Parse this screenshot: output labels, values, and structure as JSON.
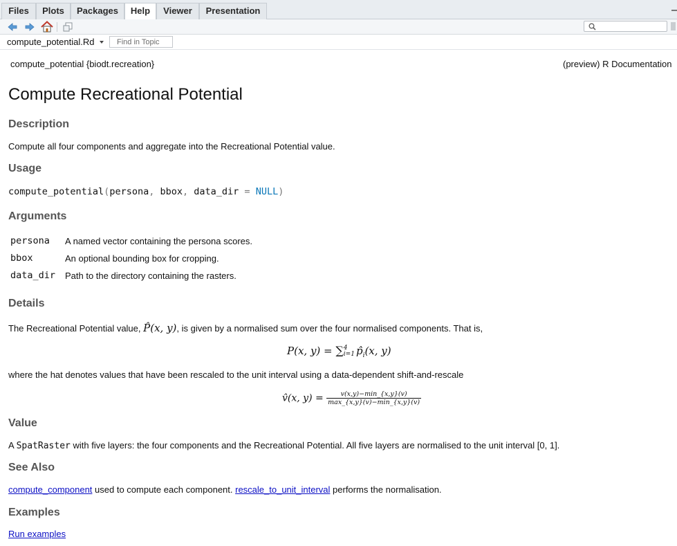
{
  "tabs": [
    "Files",
    "Plots",
    "Packages",
    "Help",
    "Viewer",
    "Presentation"
  ],
  "active_tab": "Help",
  "topic": {
    "name": "compute_potential.Rd",
    "find_placeholder": "Find in Topic"
  },
  "doc": {
    "header_left": "compute_potential {biodt.recreation}",
    "header_right": "(preview) R Documentation",
    "title": "Compute Recreational Potential",
    "description_heading": "Description",
    "description": "Compute all four components and aggregate into the Recreational Potential value.",
    "usage_heading": "Usage",
    "usage": {
      "fn": "compute_potential",
      "open": "(",
      "arg1": "persona",
      "comma1": ", ",
      "arg2": "bbox",
      "comma2": ", ",
      "arg3": "data_dir",
      "eq": " = ",
      "default": "NULL",
      "close": ")"
    },
    "arguments_heading": "Arguments",
    "arguments": [
      {
        "name": "persona",
        "desc": "A named vector containing the persona scores."
      },
      {
        "name": "bbox",
        "desc": "An optional bounding box for cropping."
      },
      {
        "name": "data_dir",
        "desc": "Path to the directory containing the rasters."
      }
    ],
    "details_heading": "Details",
    "details_pre": "The Recreational Potential value, ",
    "details_math": "P̂(x, y)",
    "details_post": ", is given by a normalised sum over the four normalised components. That is,",
    "eq1": {
      "lhs": "P(x, y) = ",
      "sum": "∑",
      "sup": "4",
      "sub": "i=1",
      "rhs": "p̂",
      "rhs_sub": "i",
      "rhs_tail": "(x, y)"
    },
    "details_mid": "where the hat denotes values that have been rescaled to the unit interval using a data-dependent shift-and-rescale",
    "eq2": {
      "lhs": "v̂(x, y) = ",
      "num": "v(x,y)−min_{x,y}(v)",
      "den": "max_{x,y}(v)−min_{x,y}(v)"
    },
    "value_heading": "Value",
    "value_pre": "A ",
    "value_code": "SpatRaster",
    "value_post": " with five layers: the four components and the Recreational Potential. All five layers are normalised to the unit interval [0, 1].",
    "seealso_heading": "See Also",
    "seealso_link1": "compute_component",
    "seealso_text1": " used to compute each component. ",
    "seealso_link2": "rescale_to_unit_interval",
    "seealso_text2": " performs the normalisation.",
    "examples_heading": "Examples",
    "run_examples": "Run examples"
  },
  "icons": [
    "back-arrow-icon",
    "forward-arrow-icon",
    "home-icon",
    "print-icon",
    "search-icon"
  ]
}
